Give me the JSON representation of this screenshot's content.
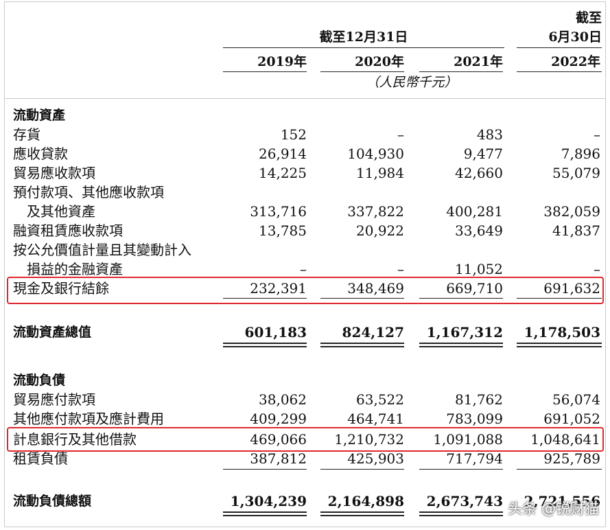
{
  "header": {
    "period_main": "截至12月31日",
    "period_interim_line1": "截至",
    "period_interim_line2": "6月30日",
    "years": [
      "2019年",
      "2020年",
      "2021年",
      "2022年"
    ],
    "unit": "（人民幣千元）"
  },
  "current_assets": {
    "heading": "流動資產",
    "rows": [
      {
        "label": "存貨",
        "values": [
          "152",
          "–",
          "483",
          "–"
        ]
      },
      {
        "label": "應收貸款",
        "values": [
          "26,914",
          "104,930",
          "9,477",
          "7,896"
        ]
      },
      {
        "label": "貿易應收款項",
        "values": [
          "14,225",
          "11,984",
          "42,660",
          "55,079"
        ]
      },
      {
        "label": "預付款項、其他應收款項",
        "label2": "及其他資產",
        "values": [
          "313,716",
          "337,822",
          "400,281",
          "382,059"
        ]
      },
      {
        "label": "融資租賃應收款項",
        "values": [
          "13,785",
          "20,922",
          "33,649",
          "41,837"
        ]
      },
      {
        "label": "按公允價值計量且其變動計入",
        "label2": "損益的金融資產",
        "values": [
          "–",
          "–",
          "11,052",
          "–"
        ]
      },
      {
        "label": "現金及銀行結餘",
        "values": [
          "232,391",
          "348,469",
          "669,710",
          "691,632"
        ]
      }
    ],
    "total": {
      "label": "流動資產總值",
      "values": [
        "601,183",
        "824,127",
        "1,167,312",
        "1,178,503"
      ]
    }
  },
  "current_liabilities": {
    "heading": "流動負債",
    "rows": [
      {
        "label": "貿易應付款項",
        "values": [
          "38,062",
          "63,522",
          "81,762",
          "56,074"
        ]
      },
      {
        "label": "其他應付款項及應計費用",
        "values": [
          "409,299",
          "464,741",
          "783,099",
          "691,052"
        ]
      },
      {
        "label": "計息銀行及其他借款",
        "values": [
          "469,066",
          "1,210,732",
          "1,091,088",
          "1,048,641"
        ]
      },
      {
        "label": "租賃負債",
        "values": [
          "387,812",
          "425,903",
          "717,794",
          "925,789"
        ]
      }
    ],
    "total": {
      "label": "流動負債總額",
      "values": [
        "1,304,239",
        "2,164,898",
        "2,673,743",
        "2,721,556"
      ]
    }
  },
  "watermark": "头条 @锐财猫",
  "colors": {
    "highlight_box": "#e0262c",
    "text": "#111111"
  }
}
